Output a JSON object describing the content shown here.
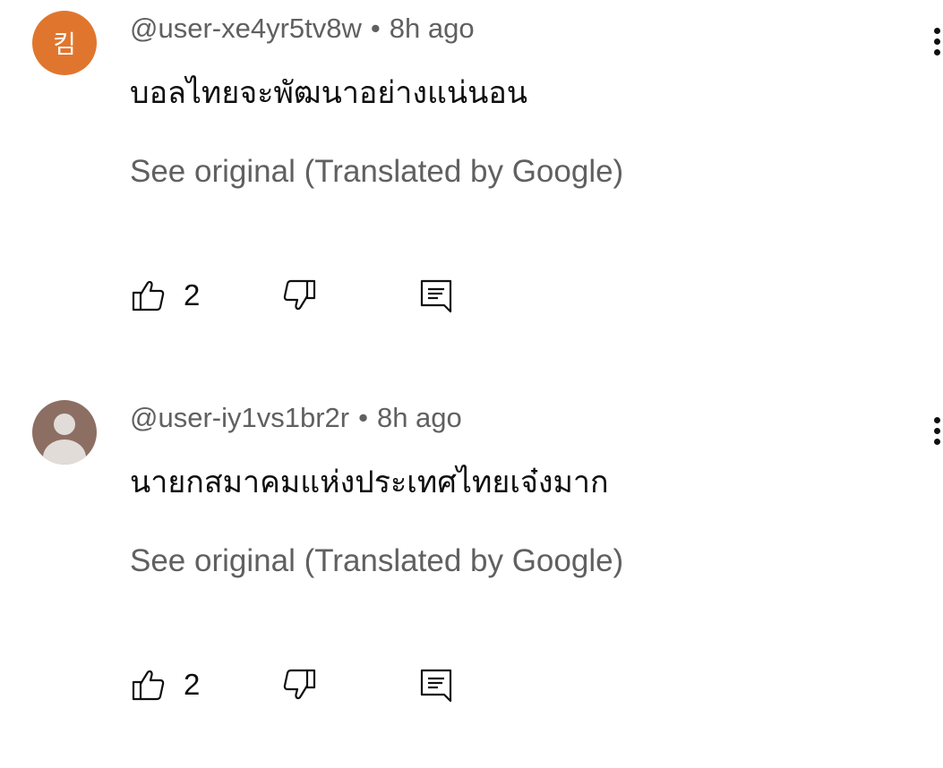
{
  "comments": [
    {
      "avatar_text": "킴",
      "avatar_color": "#e0762e",
      "author": "@user-xe4yr5tv8w",
      "separator": "•",
      "time": "8h ago",
      "text": "บอลไทยจะพัฒนาอย่างแน่นอน",
      "translate_label": "See original (Translated by Google)",
      "likes": "2"
    },
    {
      "avatar_text": "",
      "avatar_color": "#8c6f62",
      "author": "@user-iy1vs1br2r",
      "separator": "•",
      "time": "8h ago",
      "text": "นายกสมาคมแห่งประเทศไทยเจ๋งมาก",
      "translate_label": "See original (Translated by Google)",
      "likes": "2"
    }
  ],
  "icons": {
    "like": "thumb-up-icon",
    "dislike": "thumb-down-icon",
    "reply": "reply-icon",
    "menu": "more-vertical-icon"
  }
}
